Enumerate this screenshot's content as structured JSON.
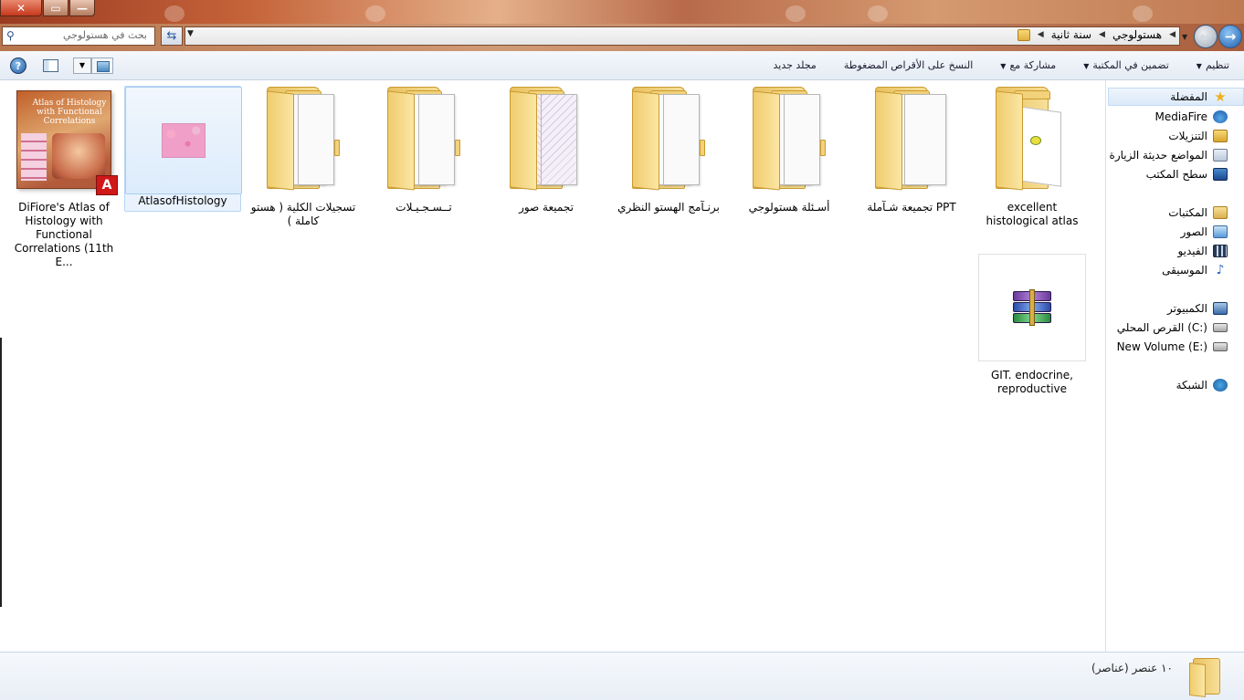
{
  "window": {
    "close_label": "✕",
    "maximize_label": "▭",
    "minimize_label": "—"
  },
  "address": {
    "crumbs": [
      "سنة ثانية",
      "هستولوجي"
    ],
    "search_placeholder": "بحث في هستولوجي"
  },
  "toolbar": {
    "organize": "تنظيم",
    "include_in_library": "تضمين في المكتبة",
    "share_with": "مشاركة مع",
    "burn": "النسخ على الأقراص المضغوطة",
    "new_folder": "مجلد جديد"
  },
  "items": [
    {
      "label": "DiFiore's Atlas of Histology with Functional Correlations (11th E...",
      "kind": "pdf"
    },
    {
      "label": "AtlasofHistology",
      "kind": "image"
    },
    {
      "label": "تسجيلات الكلية ( هستو كاملة )",
      "kind": "folder"
    },
    {
      "label": "تــسـجـيـلات",
      "kind": "folder"
    },
    {
      "label": "تجميعة صور",
      "kind": "folder"
    },
    {
      "label": "برنـآمج الهستو النظري",
      "kind": "folder"
    },
    {
      "label": "أسـئلة هستولوجي",
      "kind": "folder"
    },
    {
      "label": "تجميعة شـآملة  PPT",
      "kind": "folder"
    },
    {
      "label": "excellent histological atlas",
      "kind": "folder"
    },
    {
      "label": "GIT. endocrine, reproductive",
      "kind": "archive"
    }
  ],
  "pdf_cover": {
    "title": "Atlas of Histology with Functional Correlations",
    "badge": "A"
  },
  "nav": {
    "favorites": "المفضلة",
    "mediafire": "MediaFire",
    "downloads": "التنزيلات",
    "recent": "المواضع حديثة الزيارة",
    "desktop": "سطح المكتب",
    "libraries": "المكتبات",
    "pictures": "الصور",
    "videos": "الفيديو",
    "music": "الموسيقى",
    "computer": "الكمبيوتر",
    "local_disk": "القرص المحلي (C:)",
    "new_volume": "New Volume (E:)",
    "network": "الشبكة"
  },
  "status": {
    "count_text": "١٠ عنصر (عناصر)"
  },
  "colors": {
    "accent": "#1e5fae",
    "selection": "#dcebfb",
    "folder": "#f2d27a"
  }
}
